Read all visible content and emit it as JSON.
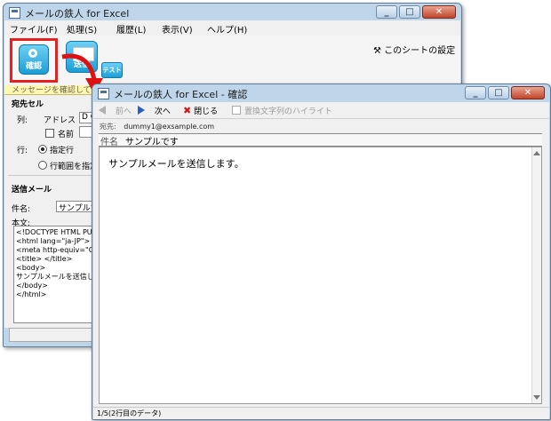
{
  "back_window": {
    "title": "メールの鉄人 for Excel",
    "menu": [
      "ファイル(F)",
      "処理(S)",
      "履歴(L)",
      "表示(V)",
      "ヘルプ(H)"
    ],
    "tools": {
      "confirm": "確認",
      "send": "送信",
      "test": "テスト"
    },
    "sheet_settings": "このシートの設定",
    "notice_bar": "メッセージを確認してから送信します",
    "recipient_cell": {
      "heading": "宛先セル",
      "column_label": "列:",
      "address_label": "アドレス",
      "address_value": "D C",
      "name_label": "名前",
      "row_label": "行:",
      "opt_specified": "指定行",
      "opt_range": "行範囲を指定"
    },
    "send_mail": {
      "heading": "送信メール",
      "subject_label": "件名:",
      "subject_value": "サンプルで",
      "body_label": "本文:",
      "body_lines": [
        "<!DOCTYPE HTML PUBL",
        "<html lang=\"ja-JP\">",
        "<meta http-equiv=\"Cont",
        "<title> </title>",
        "<body>",
        "サンプルメールを送信します",
        "</body>",
        "</html>"
      ]
    }
  },
  "front_window": {
    "title": "メールの鉄人 for Excel - 確認",
    "toolbar": {
      "prev": "前へ",
      "next": "次へ",
      "close": "閉じる",
      "highlight": "置換文字列のハイライト"
    },
    "to_label": "宛先:",
    "to_value": "dummy1@exsample.com",
    "subject_label": "件名",
    "subject_value": "サンプルです",
    "message": "サンプルメールを送信します。",
    "status": "1/5(2行目のデータ)"
  }
}
